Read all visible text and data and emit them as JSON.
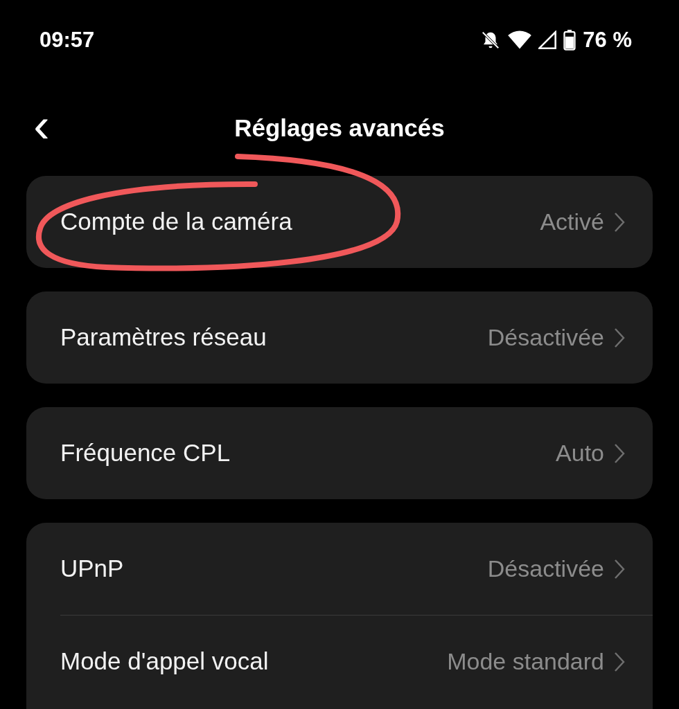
{
  "status_bar": {
    "time": "09:57",
    "battery_text": "76 %"
  },
  "header": {
    "back": "‹",
    "title": "Réglages avancés"
  },
  "groups": [
    {
      "rows": [
        {
          "label": "Compte de la caméra",
          "value": "Activé"
        }
      ]
    },
    {
      "rows": [
        {
          "label": "Paramètres réseau",
          "value": "Désactivée"
        }
      ]
    },
    {
      "rows": [
        {
          "label": "Fréquence CPL",
          "value": "Auto"
        }
      ]
    },
    {
      "rows": [
        {
          "label": "UPnP",
          "value": "Désactivée"
        },
        {
          "label": "Mode d'appel vocal",
          "value": "Mode standard"
        }
      ]
    }
  ],
  "annotations": [
    {
      "kind": "ellipse"
    }
  ]
}
